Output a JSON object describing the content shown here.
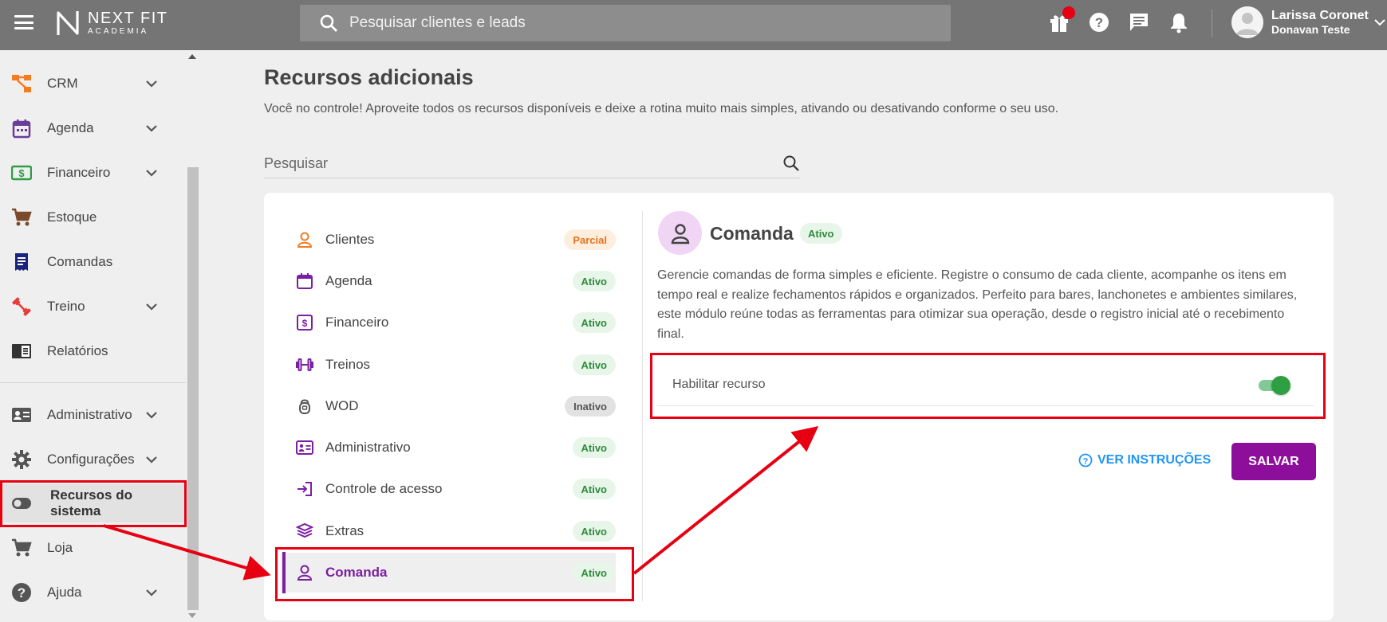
{
  "topbar": {
    "logo_name": "NEXT FIT",
    "logo_sub": "ACADEMIA",
    "search_placeholder": "Pesquisar clientes e leads",
    "user_name": "Larissa Coronet",
    "user_company": "Donavan Teste"
  },
  "sidebar": {
    "items": [
      {
        "label": "CRM",
        "icon": "crm-icon",
        "color": "#f47b20"
      },
      {
        "label": "Agenda",
        "icon": "calendar-icon",
        "color": "#6a3d9a"
      },
      {
        "label": "Financeiro",
        "icon": "money-icon",
        "color": "#2ea043"
      },
      {
        "label": "Estoque",
        "icon": "cart-icon",
        "color": "#7a4a2a"
      },
      {
        "label": "Comandas",
        "icon": "receipt-icon",
        "color": "#1a237e"
      },
      {
        "label": "Treino",
        "icon": "dumbbell-icon",
        "color": "#e53935"
      },
      {
        "label": "Relatórios",
        "icon": "report-icon",
        "color": "#333333"
      },
      {
        "label": "Administrativo",
        "icon": "id-card-icon",
        "color": "#555555"
      },
      {
        "label": "Configurações",
        "icon": "gear-icon",
        "color": "#555555"
      },
      {
        "label": "Recursos do sistema",
        "icon": "toggle-icon",
        "color": "#555555"
      },
      {
        "label": "Loja",
        "icon": "cart-icon",
        "color": "#555555"
      },
      {
        "label": "Ajuda",
        "icon": "help-icon",
        "color": "#555555"
      }
    ]
  },
  "main": {
    "title": "Recursos adicionais",
    "subtitle": "Você no controle! Aproveite todos os recursos disponíveis e deixe a rotina muito mais simples, ativando ou desativando conforme o seu uso.",
    "search_placeholder": "Pesquisar",
    "resources": [
      {
        "label": "Clientes",
        "status": "Parcial",
        "icon": "user-icon"
      },
      {
        "label": "Agenda",
        "status": "Ativo",
        "icon": "calendar-icon"
      },
      {
        "label": "Financeiro",
        "status": "Ativo",
        "icon": "money-icon"
      },
      {
        "label": "Treinos",
        "status": "Ativo",
        "icon": "dumbbell-icon"
      },
      {
        "label": "WOD",
        "status": "Inativo",
        "icon": "kettlebell-icon"
      },
      {
        "label": "Administrativo",
        "status": "Ativo",
        "icon": "id-card-icon"
      },
      {
        "label": "Controle de acesso",
        "status": "Ativo",
        "icon": "login-icon"
      },
      {
        "label": "Extras",
        "status": "Ativo",
        "icon": "layers-icon"
      },
      {
        "label": "Comanda",
        "status": "Ativo",
        "icon": "user-icon"
      }
    ],
    "detail": {
      "title": "Comanda",
      "status": "Ativo",
      "description": "Gerencie comandas de forma simples e eficiente. Registre o consumo de cada cliente, acompanhe os itens em tempo real e realize fechamentos rápidos e organizados. Perfeito para bares, lanchonetes e ambientes similares, este módulo reúne todas as ferramentas para otimizar sua operação, desde o registro inicial até o recebimento final.",
      "enable_label": "Habilitar recurso",
      "enabled": true,
      "instructions_label": "VER INSTRUÇÕES",
      "save_label": "SALVAR"
    }
  },
  "colors": {
    "accent": "#8e0e9c",
    "active_green": "#2e8b3d",
    "highlight_red": "#e60012",
    "link_blue": "#2196f3"
  }
}
